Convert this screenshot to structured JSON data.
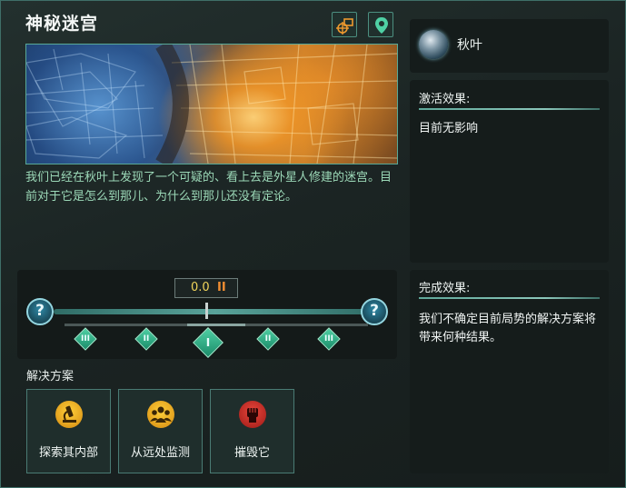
{
  "event": {
    "title": "神秘迷宫",
    "description": "我们已经在秋叶上发现了一个可疑的、看上去是外星人修建的迷宫。目前对于它是怎么到那儿、为什么到那儿还没有定论。"
  },
  "header_icons": [
    "camera-target-icon",
    "map-pin-icon"
  ],
  "timeline": {
    "value": "0.0",
    "pause_symbol": "II",
    "left_help": "?",
    "right_help": "?",
    "markers": [
      "III",
      "II",
      "I",
      "II",
      "III"
    ]
  },
  "solutions": {
    "label": "解决方案",
    "options": [
      {
        "label": "探索其内部",
        "icon": "microscope-icon"
      },
      {
        "label": "从远处监测",
        "icon": "observers-icon"
      },
      {
        "label": "摧毁它",
        "icon": "fist-icon"
      }
    ]
  },
  "planet": {
    "name": "秋叶",
    "icon": "planet-icon"
  },
  "activation": {
    "heading": "激活效果:",
    "text": "目前无影响"
  },
  "completion": {
    "heading": "完成效果:",
    "text": "我们不确定目前局势的解决方案将带来何种结果。"
  },
  "colors": {
    "accent": "#4fd0a4",
    "frame": "#3f6f68",
    "value_text": "#f0d35a",
    "pause": "#ef8d32"
  }
}
